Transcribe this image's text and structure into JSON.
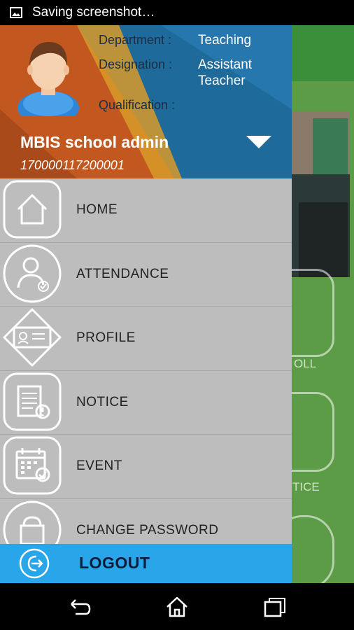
{
  "status_bar": {
    "text": "Saving screenshot…",
    "icon": "image-icon"
  },
  "profile": {
    "department_label": "Department :",
    "department_value": "Teaching",
    "designation_label": "Designation :",
    "designation_value_line1": "Assistant",
    "designation_value_line2": "Teacher",
    "qualification_label": "Qualification :",
    "name": "MBIS school admin",
    "id": "170000117200001"
  },
  "menu": {
    "items": [
      {
        "label": "HOME",
        "icon": "home-icon"
      },
      {
        "label": "ATTENDANCE",
        "icon": "user-check-icon"
      },
      {
        "label": "PROFILE",
        "icon": "id-card-icon"
      },
      {
        "label": "NOTICE",
        "icon": "notice-icon"
      },
      {
        "label": "EVENT",
        "icon": "calendar-icon"
      },
      {
        "label": "CHANGE PASSWORD",
        "icon": "lock-icon"
      }
    ]
  },
  "logout": {
    "label": "LOGOUT",
    "icon": "logout-icon"
  },
  "background": {
    "labels": [
      "OLL",
      "TICE"
    ]
  },
  "colors": {
    "header_orange": "#c2581f",
    "header_blue": "#1e6a9a",
    "logout_blue": "#29a6ea",
    "drawer_gray": "#bdbdbd",
    "bg_green": "#5d9c46"
  },
  "nav_bar": {
    "buttons": [
      "back-icon",
      "home-icon",
      "recents-icon"
    ]
  }
}
